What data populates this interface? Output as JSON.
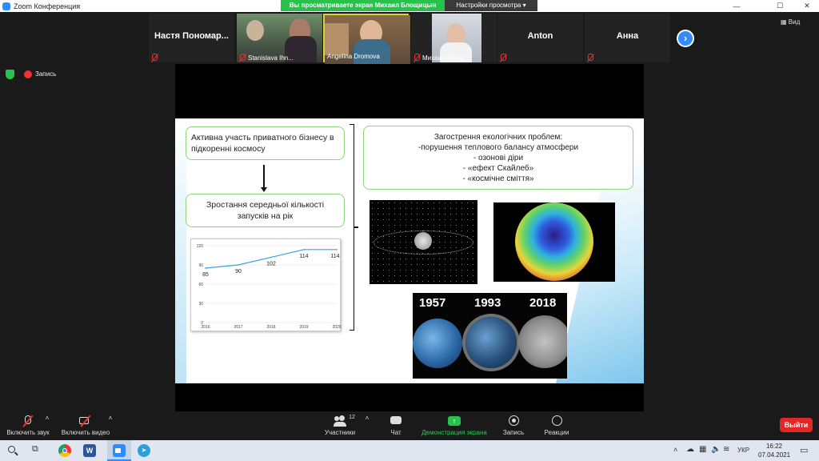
{
  "window": {
    "title": "Zoom Конференция"
  },
  "banner": {
    "sharing_text": "Вы просматриваете экран Михаил Блощицын",
    "view_settings": "Настройки просмотра"
  },
  "participants": [
    {
      "name": "Настя  Пономар...",
      "caption": ""
    },
    {
      "name": "",
      "caption": "Stanislava Ihn..."
    },
    {
      "name": "",
      "caption": "Angelina Dromova"
    },
    {
      "name": "",
      "caption": "Михаил Блощ..."
    },
    {
      "name": "Anton",
      "caption": ""
    },
    {
      "name": "Анна",
      "caption": ""
    }
  ],
  "view_button": "Вид",
  "recording_label": "Запись",
  "slide": {
    "box1": "Активна участь приватного бізнесу в підкоренні космосу",
    "box2": "Зростання середньої кількості запусків на рік",
    "box3_title": "Загострення екологічних проблем:",
    "box3_items": [
      "-порушення теплового балансу атмосфери",
      "-   озонові діри",
      "-   «ефект Скайлеб»",
      "-   «космічне сміття»"
    ],
    "years_image_labels": [
      "1957",
      "1993",
      "2018"
    ]
  },
  "chart_data": {
    "type": "line",
    "x": [
      "2016",
      "2017",
      "2018",
      "2019",
      "2020"
    ],
    "series": [
      {
        "values": [
          85,
          90,
          102,
          114,
          114
        ]
      }
    ],
    "data_labels": [
      "85",
      "90",
      "102",
      "114",
      "114"
    ],
    "yticks": [
      "0",
      "30",
      "60",
      "90",
      "120"
    ],
    "ylim": [
      0,
      120
    ],
    "color": "#3aa0e8",
    "grid": true
  },
  "toolbar": {
    "mute": "Включить звук",
    "video": "Включить видео",
    "participants": "Участники",
    "participants_count": "12",
    "chat": "Чат",
    "share": "Демонстрация экрана",
    "record": "Запись",
    "reactions": "Реакции",
    "leave": "Выйти"
  },
  "taskbar": {
    "time": "16:22",
    "date": "07.04.2021",
    "lang": "УКР"
  },
  "colors": {
    "accent": "#2d8cff",
    "share_green": "#27c24c",
    "leave_red": "#e02828",
    "box_border": "#90d47a"
  }
}
